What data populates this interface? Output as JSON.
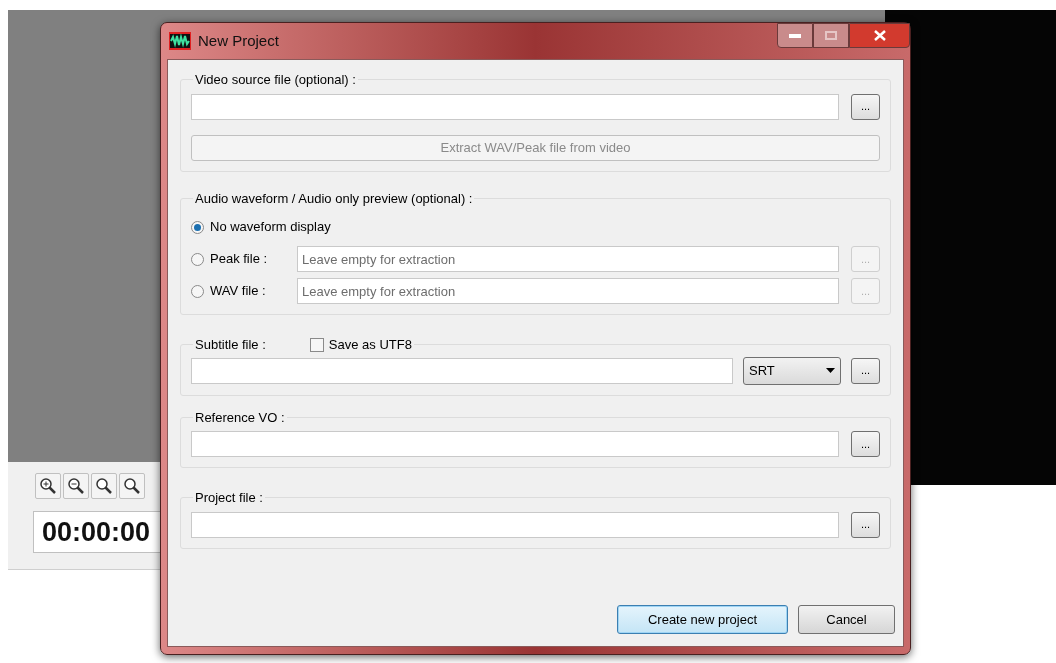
{
  "window": {
    "title": "New Project"
  },
  "background": {
    "timecode": "00:00:00"
  },
  "video_source": {
    "label": "Video source file (optional) :",
    "browse": "...",
    "extract_button": {
      "label": "Extract WAV/Peak file from video",
      "disabled": true
    }
  },
  "audio": {
    "label": "Audio waveform / Audio only preview (optional) :",
    "options": [
      {
        "kind": "plain",
        "label": "No waveform display",
        "selected": true
      },
      {
        "kind": "file",
        "label": "Peak file :",
        "selected": false,
        "placeholder": "Leave empty for extraction",
        "browse": "...",
        "disabled": true
      },
      {
        "kind": "file",
        "label": "WAV file :",
        "selected": false,
        "placeholder": "Leave empty for extraction",
        "browse": "...",
        "disabled": true
      }
    ]
  },
  "subtitle": {
    "label": "Subtitle file :",
    "save_utf8": {
      "label": "Save as UTF8",
      "checked": false
    },
    "format": "SRT",
    "browse": "..."
  },
  "reference_vo": {
    "label": "Reference VO :",
    "browse": "..."
  },
  "project_file": {
    "label": "Project file :",
    "browse": "..."
  },
  "buttons": [
    {
      "label": "Create new project",
      "default": true
    },
    {
      "label": "Cancel",
      "default": false
    }
  ]
}
